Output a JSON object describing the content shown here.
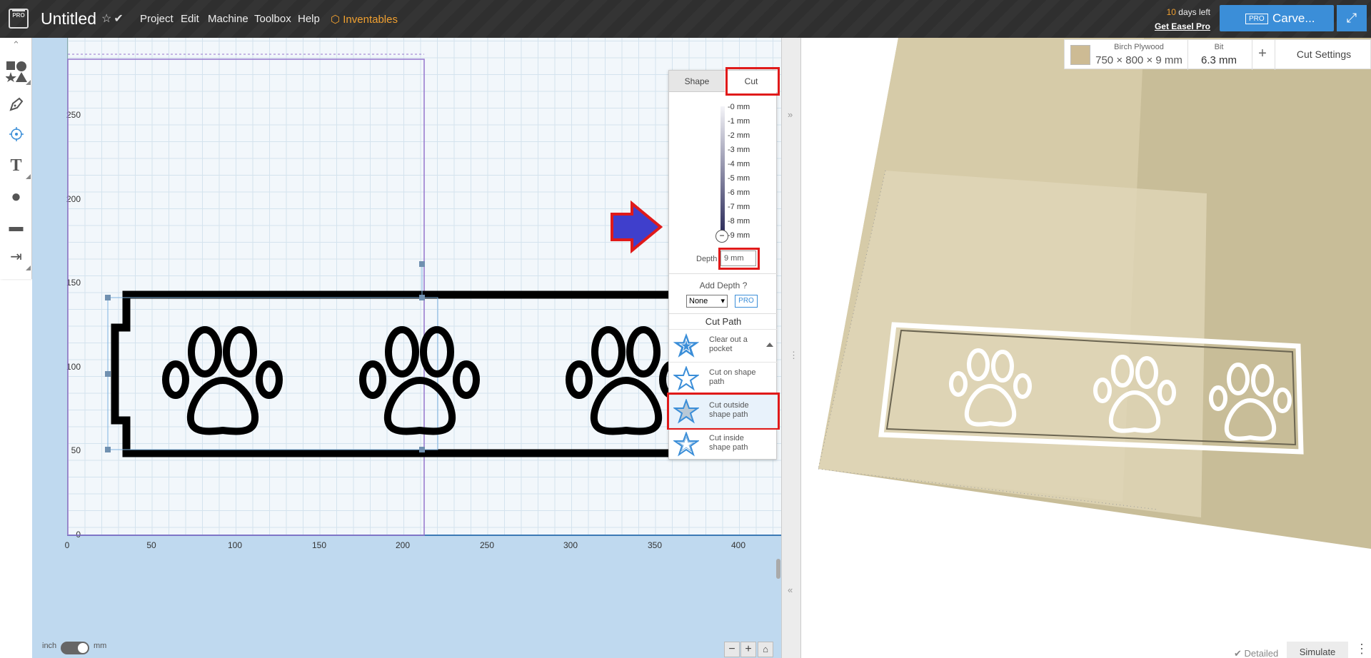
{
  "header": {
    "logo_text": "PRO",
    "title": "Untitled",
    "menu": [
      "Project",
      "Edit",
      "Machine",
      "Toolbox",
      "Help"
    ],
    "inventables": "Inventables",
    "days_count": "10",
    "days_text": " days left",
    "get_pro": "Get Easel Pro",
    "carve_badge": "PRO",
    "carve_label": "Carve..."
  },
  "canvas": {
    "y_ticks": [
      "250",
      "200",
      "150",
      "100",
      "50",
      "0"
    ],
    "x_ticks": [
      "0",
      "50",
      "100",
      "150",
      "200",
      "250",
      "300",
      "350",
      "400"
    ],
    "unit_left": "inch",
    "unit_right": "mm"
  },
  "panel": {
    "tab_shape": "Shape",
    "tab_cut": "Cut",
    "depth_ticks": [
      "-0 mm",
      "-1 mm",
      "-2 mm",
      "-3 mm",
      "-4 mm",
      "-5 mm",
      "-6 mm",
      "-7 mm",
      "-8 mm",
      "-9 mm"
    ],
    "depth_label": "Depth",
    "depth_value": "9 mm",
    "add_depth": "Add Depth",
    "add_depth_select": "None",
    "pro_label": "PRO",
    "cut_path_title": "Cut Path",
    "options": [
      "Clear out a pocket",
      "Cut on shape path",
      "Cut outside shape path",
      "Cut inside shape path"
    ],
    "selected_option": "Cut outside shape path"
  },
  "preview": {
    "material_name": "Birch Plywood",
    "material_dims": "750 × 800 × 9 mm",
    "bit_label": "Bit",
    "bit_value": "6.3 mm",
    "cut_settings": "Cut Settings",
    "detailed": "Detailed",
    "simulate": "Simulate"
  },
  "colors": {
    "accent": "#3b8ed8",
    "highlight": "#e01a1a",
    "arrow": "#3f3fcc",
    "material": "#cdbb94"
  }
}
